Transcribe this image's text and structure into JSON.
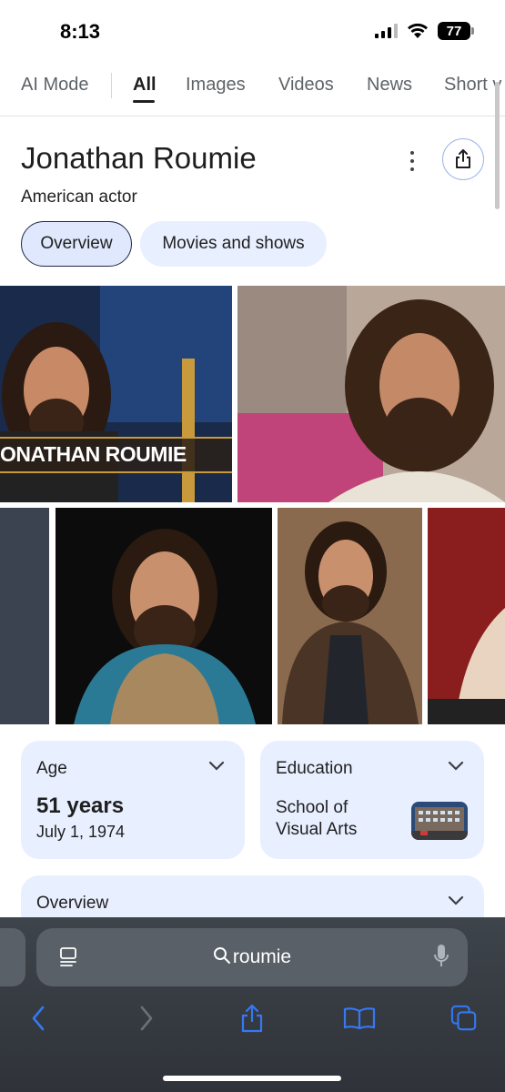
{
  "status_bar": {
    "time": "8:13",
    "battery": "77"
  },
  "tabs": [
    {
      "label": "AI Mode"
    },
    {
      "label": "All"
    },
    {
      "label": "Images"
    },
    {
      "label": "Videos"
    },
    {
      "label": "News"
    },
    {
      "label": "Short v"
    }
  ],
  "entity": {
    "name": "Jonathan Roumie",
    "description": "American actor"
  },
  "chips": [
    {
      "label": "Overview"
    },
    {
      "label": "Movies and shows"
    }
  ],
  "images": {
    "banner_text": "ONATHAN ROUMIE"
  },
  "cards": {
    "age": {
      "label": "Age",
      "value": "51 years",
      "sub": "July 1, 1974"
    },
    "education": {
      "label": "Education",
      "value": "School of Visual Arts"
    },
    "overview": {
      "label": "Overview"
    }
  },
  "browser": {
    "search_text": "roumie"
  },
  "colors": {
    "chip_bg": "#e8efff",
    "accent_blue": "#3478f6",
    "toolbar_bg": "#3e444b"
  }
}
